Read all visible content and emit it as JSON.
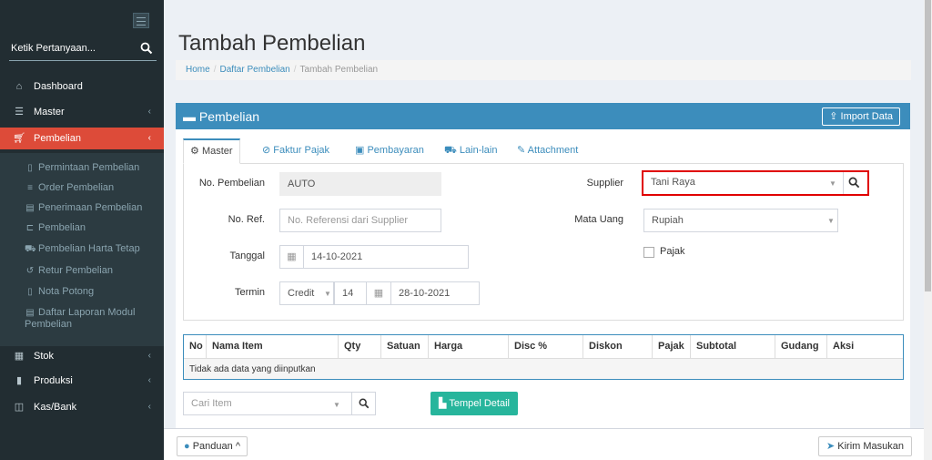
{
  "sidebar": {
    "search_placeholder": "Ketik Pertanyaan...",
    "items": [
      {
        "label": "Dashboard",
        "icon": "home-icon"
      },
      {
        "label": "Master",
        "icon": "database-icon"
      },
      {
        "label": "Pembelian",
        "icon": "cart-icon"
      },
      {
        "label": "Stok",
        "icon": "box-icon"
      },
      {
        "label": "Produksi",
        "icon": "chart-icon"
      },
      {
        "label": "Kas/Bank",
        "icon": "money-icon"
      }
    ],
    "sub_items": [
      {
        "label": "Permintaan Pembelian"
      },
      {
        "label": "Order Pembelian"
      },
      {
        "label": "Penerimaan Pembelian"
      },
      {
        "label": "Pembelian"
      },
      {
        "label": "Pembelian Harta Tetap"
      },
      {
        "label": "Retur Pembelian"
      },
      {
        "label": "Nota Potong"
      },
      {
        "label": "Daftar Laporan Modul Pembelian"
      }
    ]
  },
  "page": {
    "title": "Tambah Pembelian"
  },
  "breadcrumb": {
    "home": "Home",
    "list": "Daftar Pembelian",
    "current": "Tambah Pembelian"
  },
  "box": {
    "title": "Pembelian",
    "import_label": "Import Data"
  },
  "tabs": [
    {
      "label": "Master"
    },
    {
      "label": "Faktur Pajak"
    },
    {
      "label": "Pembayaran"
    },
    {
      "label": "Lain-lain"
    },
    {
      "label": "Attachment"
    }
  ],
  "form": {
    "no_pembelian_label": "No. Pembelian",
    "no_pembelian_value": "AUTO",
    "no_ref_label": "No. Ref.",
    "no_ref_placeholder": "No. Referensi dari Supplier",
    "tanggal_label": "Tanggal",
    "tanggal_value": "14-10-2021",
    "termin_label": "Termin",
    "termin_type": "Credit",
    "termin_days": "14",
    "termin_date": "28-10-2021",
    "supplier_label": "Supplier",
    "supplier_value": "Tani Raya",
    "mata_uang_label": "Mata Uang",
    "mata_uang_value": "Rupiah",
    "pajak_label": "Pajak"
  },
  "table": {
    "columns": [
      "No",
      "Nama Item",
      "Qty",
      "Satuan",
      "Harga",
      "Disc %",
      "Diskon",
      "Pajak",
      "Subtotal",
      "Gudang",
      "Aksi"
    ],
    "empty_text": "Tidak ada data yang diinputkan"
  },
  "item_search": {
    "placeholder": "Cari Item"
  },
  "buttons": {
    "tempel_detail": "Tempel Detail",
    "panduan": "Panduan",
    "kirim_masukan": "Kirim Masukan"
  },
  "colors": {
    "sidebar_bg": "#222d32",
    "active_menu": "#dd4b39",
    "primary": "#3c8dbc",
    "highlight": "#e00000",
    "teal_button": "#27b59c"
  }
}
